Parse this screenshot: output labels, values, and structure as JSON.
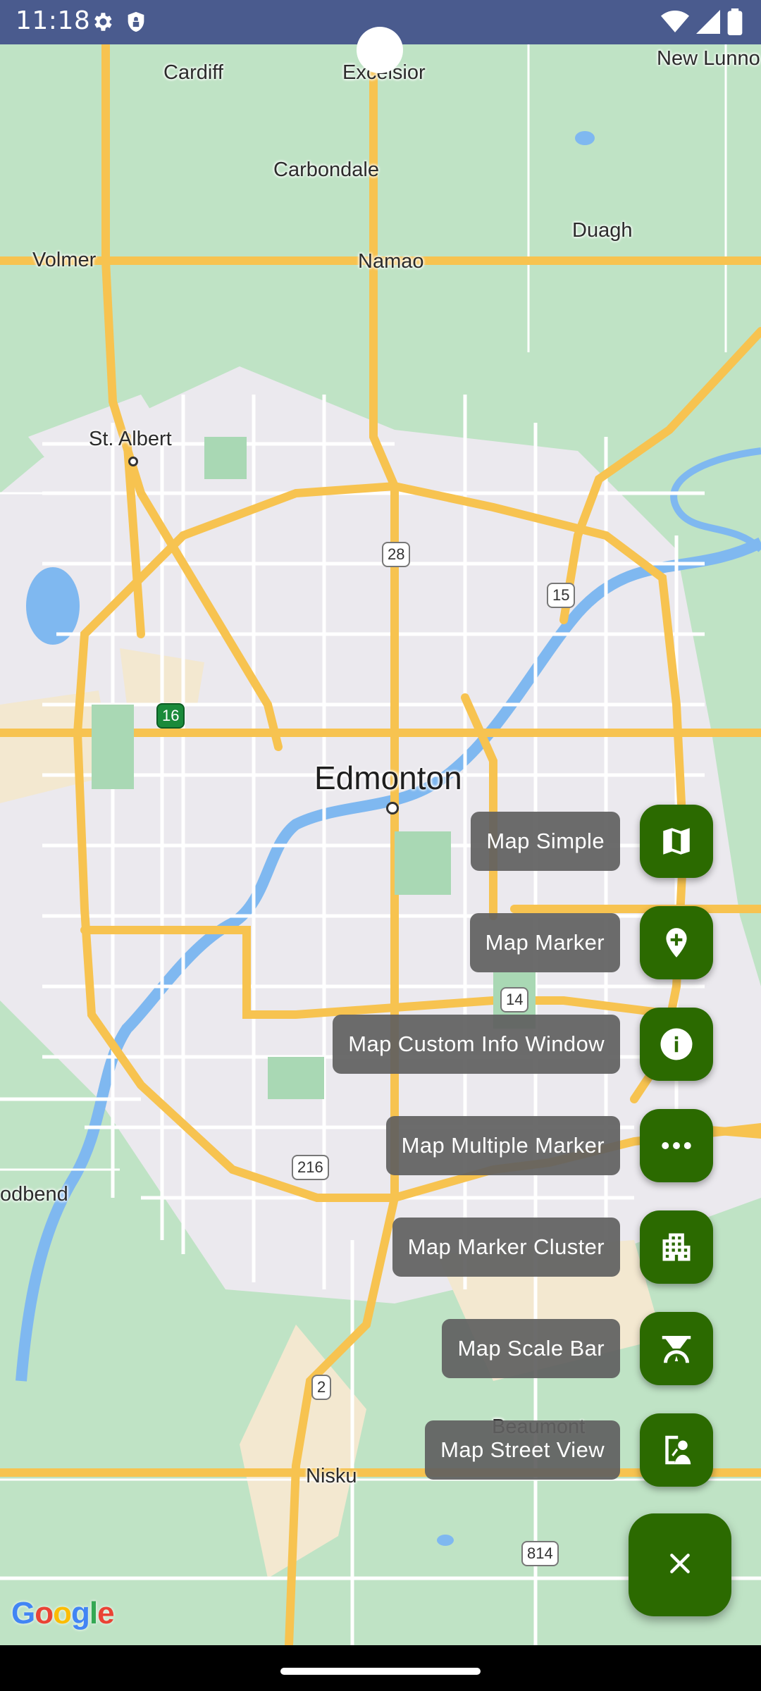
{
  "status_bar": {
    "time": "11:18",
    "left_icons": [
      "gear-icon",
      "shield-icon"
    ],
    "right_icons": [
      "wifi-icon",
      "signal-icon",
      "battery-icon"
    ],
    "background": "#4a5b8e"
  },
  "map": {
    "places": [
      {
        "name": "Cardiff"
      },
      {
        "name": "Excelsior"
      },
      {
        "name": "New Lunno"
      },
      {
        "name": "Carbondale"
      },
      {
        "name": "Duagh"
      },
      {
        "name": "Volmer"
      },
      {
        "name": "Namao"
      },
      {
        "name": "St. Albert"
      },
      {
        "name": "Edmonton"
      },
      {
        "name": "odbend"
      },
      {
        "name": "Beaumont"
      },
      {
        "name": "Nisku"
      }
    ],
    "highway_shields": [
      "28",
      "15",
      "16",
      "14",
      "216",
      "2",
      "814"
    ],
    "attribution": "Google"
  },
  "fab_menu": {
    "items": [
      {
        "label": "Map Simple",
        "icon": "map-icon"
      },
      {
        "label": "Map Marker",
        "icon": "add-location-icon"
      },
      {
        "label": "Map Custom Info Window",
        "icon": "info-icon"
      },
      {
        "label": "Map Multiple Marker",
        "icon": "more-horiz-icon"
      },
      {
        "label": "Map Marker Cluster",
        "icon": "apartment-icon"
      },
      {
        "label": "Map Scale Bar",
        "icon": "scale-icon"
      },
      {
        "label": "Map Street View",
        "icon": "street-view-icon"
      }
    ],
    "close_icon": "close-icon",
    "accent": "#2b6a00",
    "label_background": "#606060"
  }
}
